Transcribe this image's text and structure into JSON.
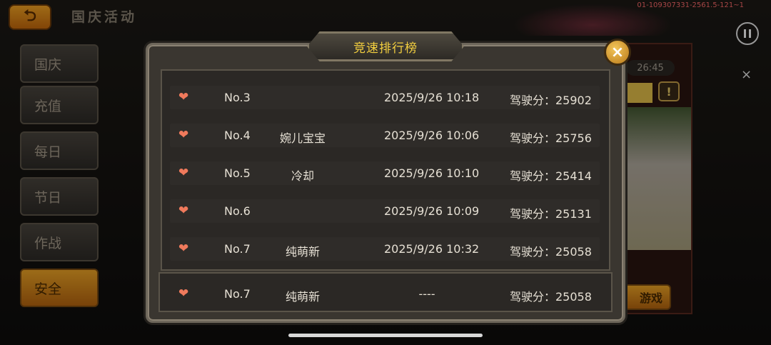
{
  "background": {
    "event_title": "国庆活动",
    "debug_id": "01-109307331-2561.5-121~1",
    "menu": [
      "国庆",
      "充值",
      "每日",
      "节日",
      "作战",
      "安全"
    ],
    "timer": "26:45",
    "play_button": "游戏"
  },
  "overlay": {
    "pause": "pause-icon",
    "close": "×"
  },
  "leaderboard": {
    "title": "竞速排行榜",
    "close_label": "×",
    "rows": [
      {
        "rank": "No.3",
        "name": "",
        "time": "2025/9/26 10:18",
        "score": "驾驶分：25902"
      },
      {
        "rank": "No.4",
        "name": "婉儿宝宝",
        "time": "2025/9/26 10:06",
        "score": "驾驶分：25756"
      },
      {
        "rank": "No.5",
        "name": "冷却",
        "time": "2025/9/26 10:10",
        "score": "驾驶分：25414"
      },
      {
        "rank": "No.6",
        "name": "",
        "time": "2025/9/26 10:09",
        "score": "驾驶分：25131"
      },
      {
        "rank": "No.7",
        "name": "纯萌新",
        "time": "2025/9/26 10:32",
        "score": "驾驶分：25058"
      }
    ],
    "my_row": {
      "rank": "No.7",
      "name": "纯萌新",
      "time": "----",
      "score": "驾驶分：25058"
    }
  },
  "colors": {
    "accent": "#f3cf3f",
    "heart": "#f07a5c",
    "button": "#f0a626"
  }
}
